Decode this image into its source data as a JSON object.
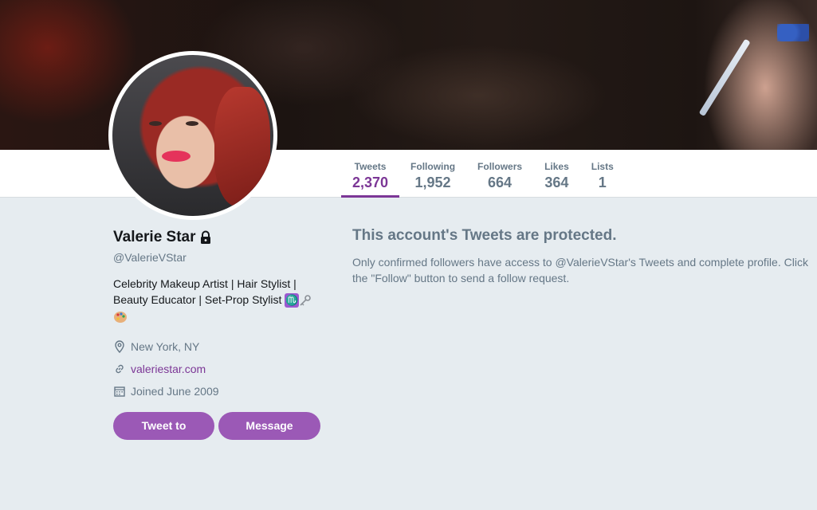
{
  "header": {
    "banner_alt": "profile-banner"
  },
  "nav": {
    "stats": [
      {
        "label": "Tweets",
        "value": "2,370",
        "active": true
      },
      {
        "label": "Following",
        "value": "1,952",
        "active": false
      },
      {
        "label": "Followers",
        "value": "664",
        "active": false
      },
      {
        "label": "Likes",
        "value": "364",
        "active": false
      },
      {
        "label": "Lists",
        "value": "1",
        "active": false
      }
    ],
    "accent_color": "#7c3796"
  },
  "profile": {
    "name": "Valerie Star",
    "protected_icon": "lock-icon",
    "handle": "@ValerieVStar",
    "bio_line1": "Celebrity Makeup Artist | Hair Stylist |",
    "bio_line2": "Beauty Educator | Set-Prop Stylist",
    "bio_emojis": [
      "scorpio-icon",
      "key-icon",
      "palette-icon"
    ],
    "location": "New York, NY",
    "website": "valeriestar.com",
    "joined": "Joined June 2009",
    "buttons": {
      "tweet_to": "Tweet to",
      "message": "Message"
    },
    "button_color": "#9b59b6"
  },
  "protected_notice": {
    "title": "This account's Tweets are protected.",
    "body": "Only confirmed followers have access to @ValerieVStar's Tweets and complete profile. Click the \"Follow\" button to send a follow request."
  }
}
